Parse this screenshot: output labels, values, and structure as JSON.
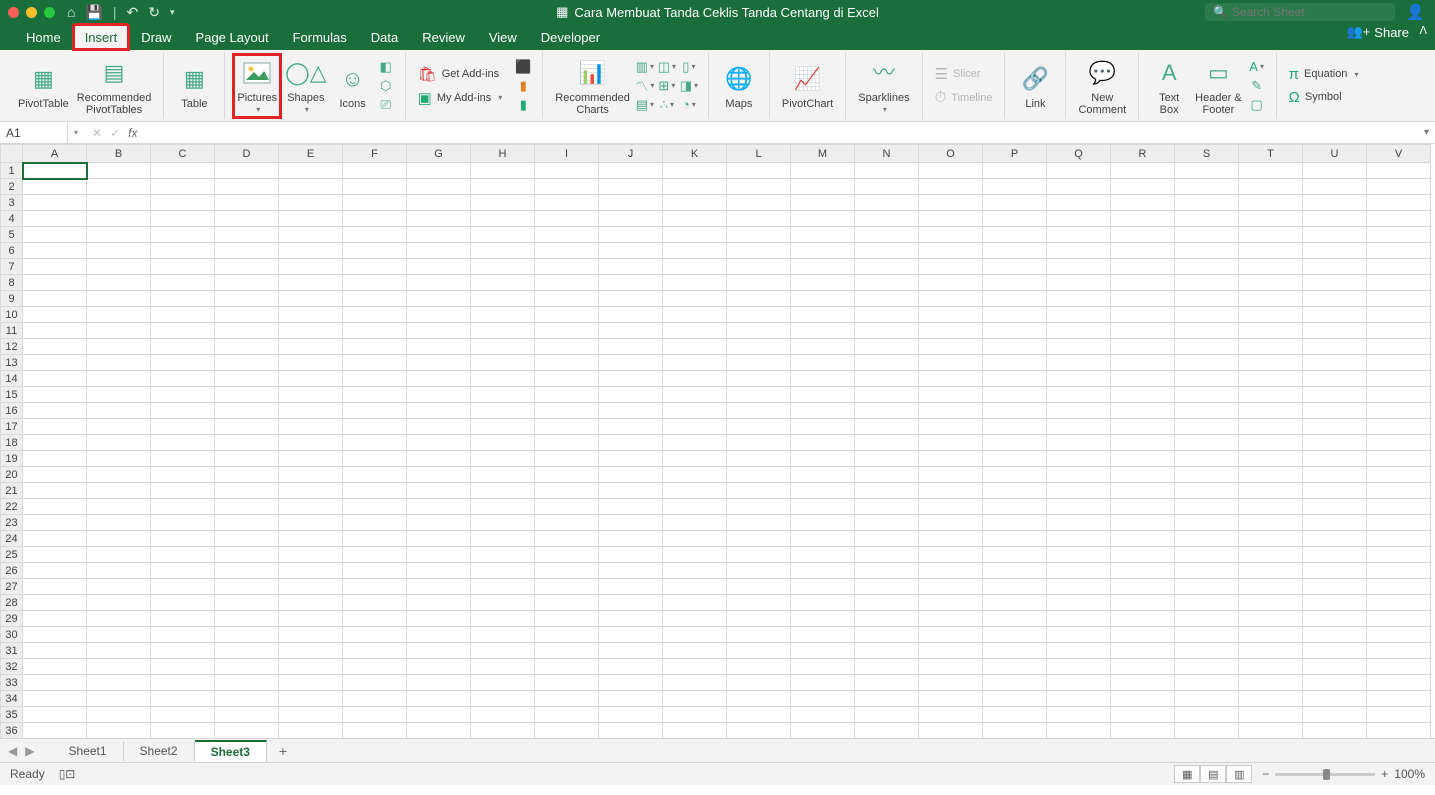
{
  "titlebar": {
    "document_title": "Cara Membuat Tanda Ceklis Tanda Centang di Excel",
    "search_placeholder": "Search Sheet"
  },
  "tabs": {
    "items": [
      "Home",
      "Insert",
      "Draw",
      "Page Layout",
      "Formulas",
      "Data",
      "Review",
      "View",
      "Developer"
    ],
    "active": "Insert",
    "share": "Share"
  },
  "ribbon": {
    "pivottable": "PivotTable",
    "recommended_pivot": "Recommended\nPivotTables",
    "table": "Table",
    "pictures": "Pictures",
    "shapes": "Shapes",
    "icons": "Icons",
    "get_addins": "Get Add-ins",
    "my_addins": "My Add-ins",
    "recommended_charts": "Recommended\nCharts",
    "maps": "Maps",
    "pivotchart": "PivotChart",
    "sparklines": "Sparklines",
    "slicer": "Slicer",
    "timeline": "Timeline",
    "link": "Link",
    "new_comment": "New\nComment",
    "text_box": "Text\nBox",
    "header_footer": "Header &\nFooter",
    "equation": "Equation",
    "symbol": "Symbol"
  },
  "formula_bar": {
    "name_box": "A1"
  },
  "grid": {
    "columns": [
      "A",
      "B",
      "C",
      "D",
      "E",
      "F",
      "G",
      "H",
      "I",
      "J",
      "K",
      "L",
      "M",
      "N",
      "O",
      "P",
      "Q",
      "R",
      "S",
      "T",
      "U",
      "V"
    ],
    "row_count": 36,
    "selected_cell": "A1"
  },
  "sheet_tabs": {
    "items": [
      "Sheet1",
      "Sheet2",
      "Sheet3"
    ],
    "active": "Sheet3"
  },
  "status": {
    "ready": "Ready",
    "zoom": "100%"
  }
}
